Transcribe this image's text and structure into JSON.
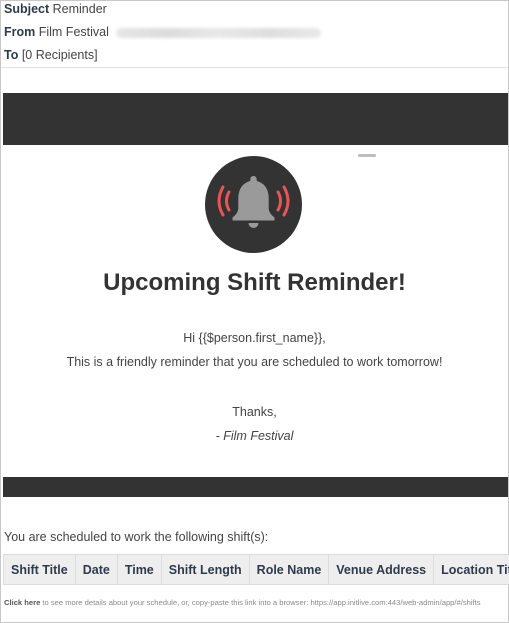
{
  "email": {
    "subject_label": "Subject",
    "subject": "Reminder",
    "from_label": "From",
    "from_name": "Film Festival",
    "to_label": "To",
    "to": "[0 Recipients]"
  },
  "body": {
    "title": "Upcoming Shift Reminder!",
    "greeting": "Hi {{$person.first_name}},",
    "message": "This is a friendly reminder that you are scheduled to work tomorrow!",
    "thanks": "Thanks,",
    "signature": "- Film Festival",
    "icon": "bell-ringing-icon",
    "colors": {
      "dark": "#333333",
      "bell": "#999999",
      "ring": "#e85555",
      "table_bg": "#eeeeee"
    }
  },
  "shifts": {
    "intro": "You are scheduled to work the following shift(s):",
    "columns": [
      "Shift Title",
      "Date",
      "Time",
      "Shift Length",
      "Role Name",
      "Venue Address",
      "Location Title"
    ]
  },
  "footer": {
    "link_label": "Click here",
    "text": " to see more details about your schedule, or, copy-paste this link into a browser: https://app.initlive.com:443/web-admin/app/#/shifts"
  }
}
